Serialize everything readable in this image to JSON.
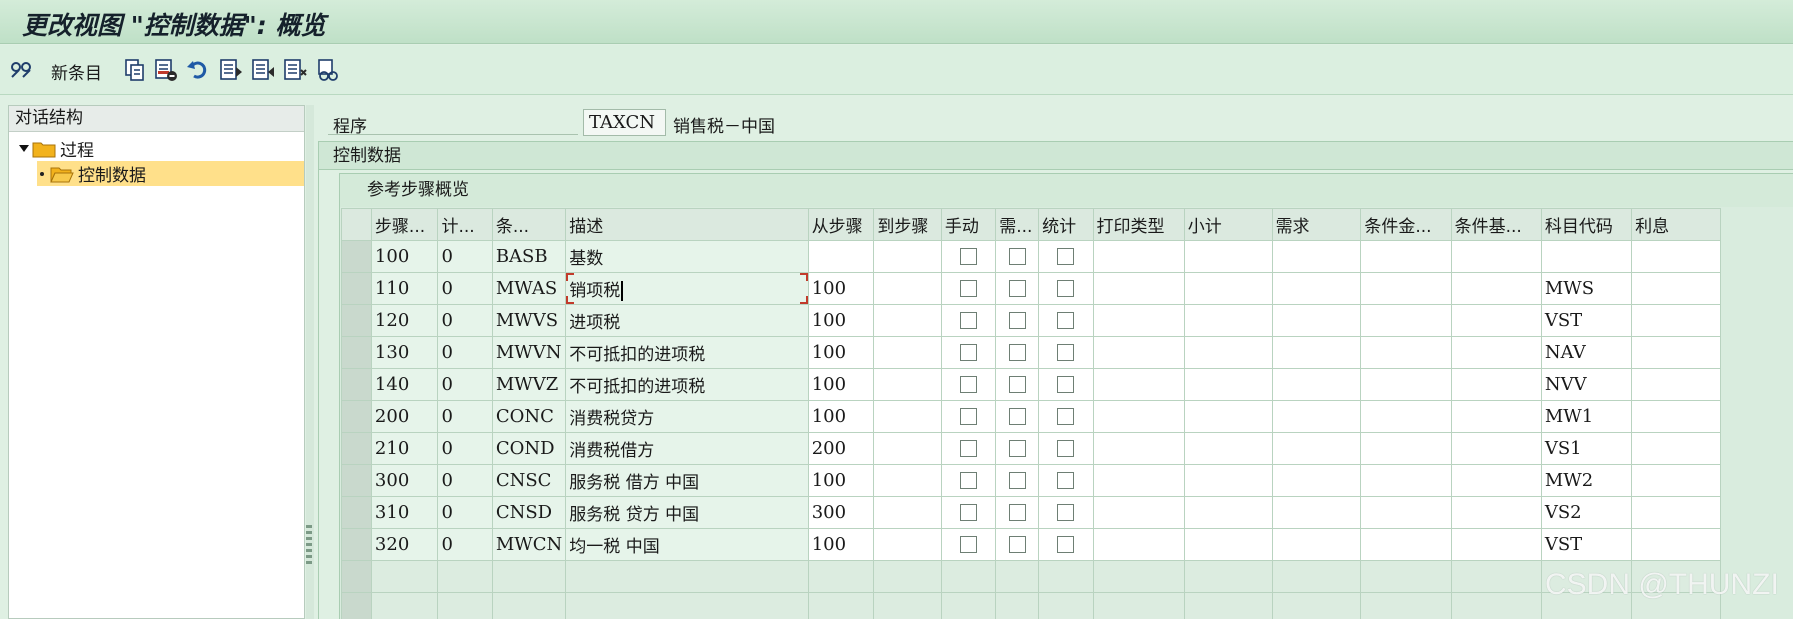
{
  "window": {
    "title": "更改视图 \"控制数据\": 概览"
  },
  "toolbar": {
    "new_entries_label": "新条目",
    "icons": [
      "display-change-icon",
      "copy-icon",
      "delete-icon",
      "undo-icon",
      "select-all-icon",
      "select-block-icon",
      "deselect-all-icon",
      "print-preview-icon"
    ]
  },
  "nav": {
    "header": "对话结构",
    "items": [
      {
        "label": "过程",
        "expanded": true
      },
      {
        "label": "控制数据",
        "selected": true
      }
    ]
  },
  "program": {
    "label": "程序",
    "value": "TAXCN",
    "description": "销售税－中国"
  },
  "groupbox": {
    "title": "控制数据"
  },
  "table": {
    "title": "参考步骤概览",
    "columns": [
      "步骤...",
      "计...",
      "条...",
      "描述",
      "从步骤",
      "到步骤",
      "手动",
      "需...",
      "统计",
      "打印类型",
      "小计",
      "需求",
      "条件金...",
      "条件基...",
      "科目代码",
      "利息"
    ],
    "rows": [
      {
        "step": "100",
        "counter": "0",
        "cond": "BASB",
        "desc": "基数",
        "from": "",
        "to": "",
        "manual": false,
        "required": false,
        "statistical": false,
        "acct": ""
      },
      {
        "step": "110",
        "counter": "0",
        "cond": "MWAS",
        "desc": "销项税",
        "from": "100",
        "to": "",
        "manual": false,
        "required": false,
        "statistical": false,
        "acct": "MWS"
      },
      {
        "step": "120",
        "counter": "0",
        "cond": "MWVS",
        "desc": "进项税",
        "from": "100",
        "to": "",
        "manual": false,
        "required": false,
        "statistical": false,
        "acct": "VST"
      },
      {
        "step": "130",
        "counter": "0",
        "cond": "MWVN",
        "desc": "不可抵扣的进项税",
        "from": "100",
        "to": "",
        "manual": false,
        "required": false,
        "statistical": false,
        "acct": "NAV"
      },
      {
        "step": "140",
        "counter": "0",
        "cond": "MWVZ",
        "desc": "不可抵扣的进项税",
        "from": "100",
        "to": "",
        "manual": false,
        "required": false,
        "statistical": false,
        "acct": "NVV"
      },
      {
        "step": "200",
        "counter": "0",
        "cond": "CONC",
        "desc": "消费税贷方",
        "from": "100",
        "to": "",
        "manual": false,
        "required": false,
        "statistical": false,
        "acct": "MW1"
      },
      {
        "step": "210",
        "counter": "0",
        "cond": "COND",
        "desc": "消费税借方",
        "from": "200",
        "to": "",
        "manual": false,
        "required": false,
        "statistical": false,
        "acct": "VS1"
      },
      {
        "step": "300",
        "counter": "0",
        "cond": "CNSC",
        "desc": "服务税 借方 中国",
        "from": "100",
        "to": "",
        "manual": false,
        "required": false,
        "statistical": false,
        "acct": "MW2"
      },
      {
        "step": "310",
        "counter": "0",
        "cond": "CNSD",
        "desc": "服务税 贷方 中国",
        "from": "300",
        "to": "",
        "manual": false,
        "required": false,
        "statistical": false,
        "acct": "VS2"
      },
      {
        "step": "320",
        "counter": "0",
        "cond": "MWCN",
        "desc": "均一税 中国",
        "from": "100",
        "to": "",
        "manual": false,
        "required": false,
        "statistical": false,
        "acct": "VST"
      }
    ]
  },
  "watermark": "CSDN @THUNZI",
  "colors": {
    "selected_node": "#ffe08a",
    "header_green": "#bfe0c7",
    "cell_green": "#e6f4ea"
  }
}
